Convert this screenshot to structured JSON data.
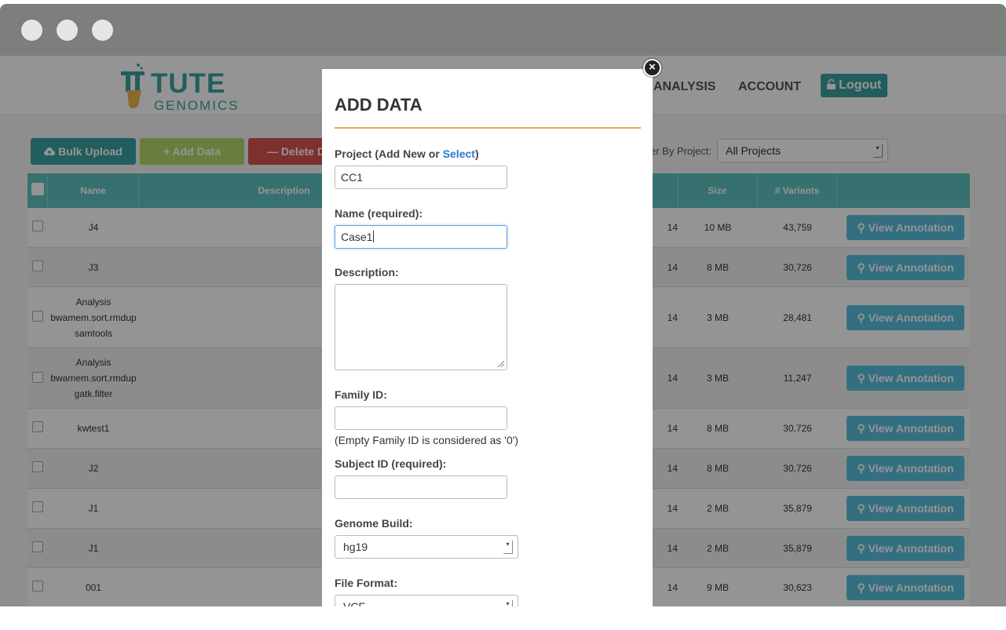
{
  "header": {
    "logo_main": "TUTE",
    "logo_sub": "GENOMICS",
    "nav": {
      "analysis": "ANALYSIS",
      "account": "ACCOUNT"
    },
    "logout": "Logout"
  },
  "toolbar": {
    "bulk_upload": "Bulk Upload",
    "add_data": "+ Add Data",
    "delete_data": "— Delete Da",
    "filter_label": "er By Project:",
    "filter_value": "All Projects"
  },
  "table": {
    "headers": {
      "name": "Name",
      "description": "Description",
      "size": "Size",
      "variants": "# Variants"
    },
    "view_label": "View Annotation",
    "rows": [
      {
        "name": "J4",
        "date": "14",
        "size": "10 MB",
        "variants": "43,759"
      },
      {
        "name": "J3",
        "date": "14",
        "size": "8 MB",
        "variants": "30,726"
      },
      {
        "name": "Analysis bwamem.sort.rmdup samtools",
        "date": "14",
        "size": "3 MB",
        "variants": "28,481"
      },
      {
        "name": "Analysis bwamem.sort.rmdup gatk.filter",
        "date": "14",
        "size": "3 MB",
        "variants": "11,247"
      },
      {
        "name": "kwtest1",
        "date": "14",
        "size": "8 MB",
        "variants": "30,726"
      },
      {
        "name": "J2",
        "date": "14",
        "size": "8 MB",
        "variants": "30,726"
      },
      {
        "name": "J1",
        "date": "14",
        "size": "2 MB",
        "variants": "35,879"
      },
      {
        "name": "J1",
        "date": "14",
        "size": "2 MB",
        "variants": "35,879"
      },
      {
        "name": "001",
        "date": "14",
        "size": "9 MB",
        "variants": "30,623"
      }
    ]
  },
  "modal": {
    "title": "ADD DATA",
    "project_label_pre": "Project (Add New or ",
    "project_label_link": "Select",
    "project_label_post": ")",
    "project_value": "CC1",
    "name_label": "Name (required):",
    "name_value": "Case1",
    "description_label": "Description:",
    "family_label": "Family ID:",
    "family_note": "(Empty Family ID is considered as '0')",
    "subject_label": "Subject ID (required):",
    "genome_label": "Genome Build:",
    "genome_value": "hg19",
    "format_label": "File Format:",
    "format_value": "VCF"
  },
  "colors": {
    "teal": "#3aa3a0",
    "header_teal": "#5fc3bf",
    "accent_orange": "#f0a64a",
    "link_blue": "#2a7bcc",
    "view_button": "#5bc0de",
    "delete_red": "#d9534f",
    "add_green": "#b5d96b"
  }
}
